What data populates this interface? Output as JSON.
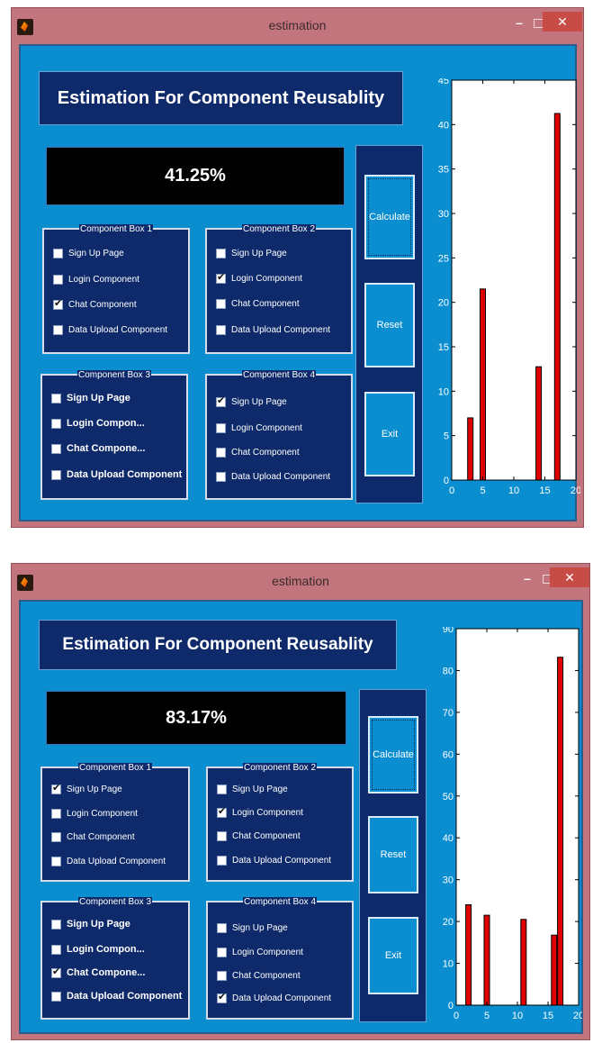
{
  "windows": [
    {
      "title": "estimation",
      "heading": "Estimation For Component Reusablity",
      "result": "41.25%",
      "buttons": {
        "calculate": "Calculate",
        "reset": "Reset",
        "exit": "Exit"
      },
      "boxes": [
        {
          "title": "Component Box 1",
          "items": [
            {
              "label": "Sign Up Page",
              "checked": false
            },
            {
              "label": "Login Component",
              "checked": false
            },
            {
              "label": "Chat Component",
              "checked": true
            },
            {
              "label": "Data Upload Component",
              "checked": false
            }
          ]
        },
        {
          "title": "Component Box 2",
          "items": [
            {
              "label": "Sign Up Page",
              "checked": false
            },
            {
              "label": "Login Component",
              "checked": true
            },
            {
              "label": "Chat Component",
              "checked": false
            },
            {
              "label": "Data Upload Component",
              "checked": false
            }
          ]
        },
        {
          "title": "Component Box 3",
          "items": [
            {
              "label": "Sign Up Page",
              "checked": false
            },
            {
              "label": "Login Compon...",
              "checked": false
            },
            {
              "label": "Chat Compone...",
              "checked": false
            },
            {
              "label": "Data Upload Component",
              "checked": false
            }
          ]
        },
        {
          "title": "Component Box 4",
          "items": [
            {
              "label": "Sign Up Page",
              "checked": true
            },
            {
              "label": "Login Component",
              "checked": false
            },
            {
              "label": "Chat Component",
              "checked": false
            },
            {
              "label": "Data Upload Component",
              "checked": false
            }
          ]
        }
      ],
      "chart_data": {
        "type": "bar",
        "title": "",
        "xlabel": "",
        "ylabel": "",
        "x": [
          3,
          5,
          14,
          17
        ],
        "values": [
          7,
          21.5,
          12.75,
          41.25
        ],
        "xlim": [
          0,
          20
        ],
        "ylim": [
          0,
          45
        ],
        "xticks": [
          0,
          5,
          10,
          15,
          20
        ],
        "yticks": [
          0,
          5,
          10,
          15,
          20,
          25,
          30,
          35,
          40,
          45
        ],
        "bar_color": "#e00000",
        "grid": false
      }
    },
    {
      "title": "estimation",
      "heading": "Estimation For Component Reusablity",
      "result": "83.17%",
      "buttons": {
        "calculate": "Calculate",
        "reset": "Reset",
        "exit": "Exit"
      },
      "boxes": [
        {
          "title": "Component Box 1",
          "items": [
            {
              "label": "Sign Up Page",
              "checked": true
            },
            {
              "label": "Login Component",
              "checked": false
            },
            {
              "label": "Chat Component",
              "checked": false
            },
            {
              "label": "Data Upload Component",
              "checked": false
            }
          ]
        },
        {
          "title": "Component Box 2",
          "items": [
            {
              "label": "Sign Up Page",
              "checked": false
            },
            {
              "label": "Login Component",
              "checked": true
            },
            {
              "label": "Chat Component",
              "checked": false
            },
            {
              "label": "Data Upload Component",
              "checked": false
            }
          ]
        },
        {
          "title": "Component Box 3",
          "items": [
            {
              "label": "Sign Up Page",
              "checked": false
            },
            {
              "label": "Login Compon...",
              "checked": false
            },
            {
              "label": "Chat Compone...",
              "checked": true
            },
            {
              "label": "Data Upload Component",
              "checked": false
            }
          ]
        },
        {
          "title": "Component Box 4",
          "items": [
            {
              "label": "Sign Up Page",
              "checked": false
            },
            {
              "label": "Login Component",
              "checked": false
            },
            {
              "label": "Chat Component",
              "checked": false
            },
            {
              "label": "Data Upload Component",
              "checked": true
            }
          ]
        }
      ],
      "chart_data": {
        "type": "bar",
        "title": "",
        "xlabel": "",
        "ylabel": "",
        "x": [
          2,
          5,
          11,
          16,
          17
        ],
        "values": [
          24,
          21.5,
          20.5,
          16.75,
          83.17
        ],
        "xlim": [
          0,
          20
        ],
        "ylim": [
          0,
          90
        ],
        "xticks": [
          0,
          5,
          10,
          15,
          20
        ],
        "yticks": [
          0,
          10,
          20,
          30,
          40,
          50,
          60,
          70,
          80,
          90
        ],
        "bar_color": "#e00000",
        "grid": false
      }
    }
  ]
}
